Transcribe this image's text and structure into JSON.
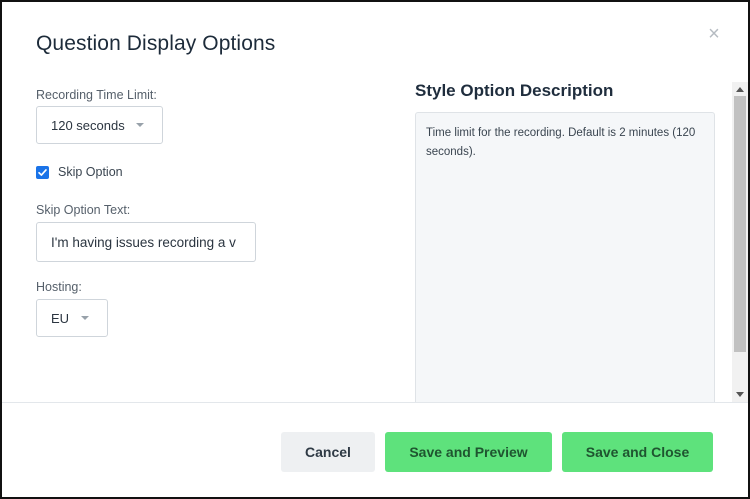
{
  "dialog": {
    "title": "Question Display Options",
    "close_icon": "close-icon",
    "close_glyph": "×"
  },
  "form": {
    "recording_time_limit": {
      "label": "Recording Time Limit:",
      "selected": "120 seconds"
    },
    "skip_option": {
      "label": "Skip Option",
      "checked": true
    },
    "skip_option_text": {
      "label": "Skip Option Text:",
      "value": "I'm having issues recording a v"
    },
    "hosting": {
      "label": "Hosting:",
      "selected": "EU"
    }
  },
  "description": {
    "title": "Style Option Description",
    "text": "Time limit for the recording. Default is 2 minutes (120 seconds)."
  },
  "footer": {
    "cancel_label": "Cancel",
    "save_preview_label": "Save and Preview",
    "save_close_label": "Save and Close"
  },
  "colors": {
    "primary_green": "#5ee27c",
    "checkbox_blue": "#1a73e8"
  }
}
